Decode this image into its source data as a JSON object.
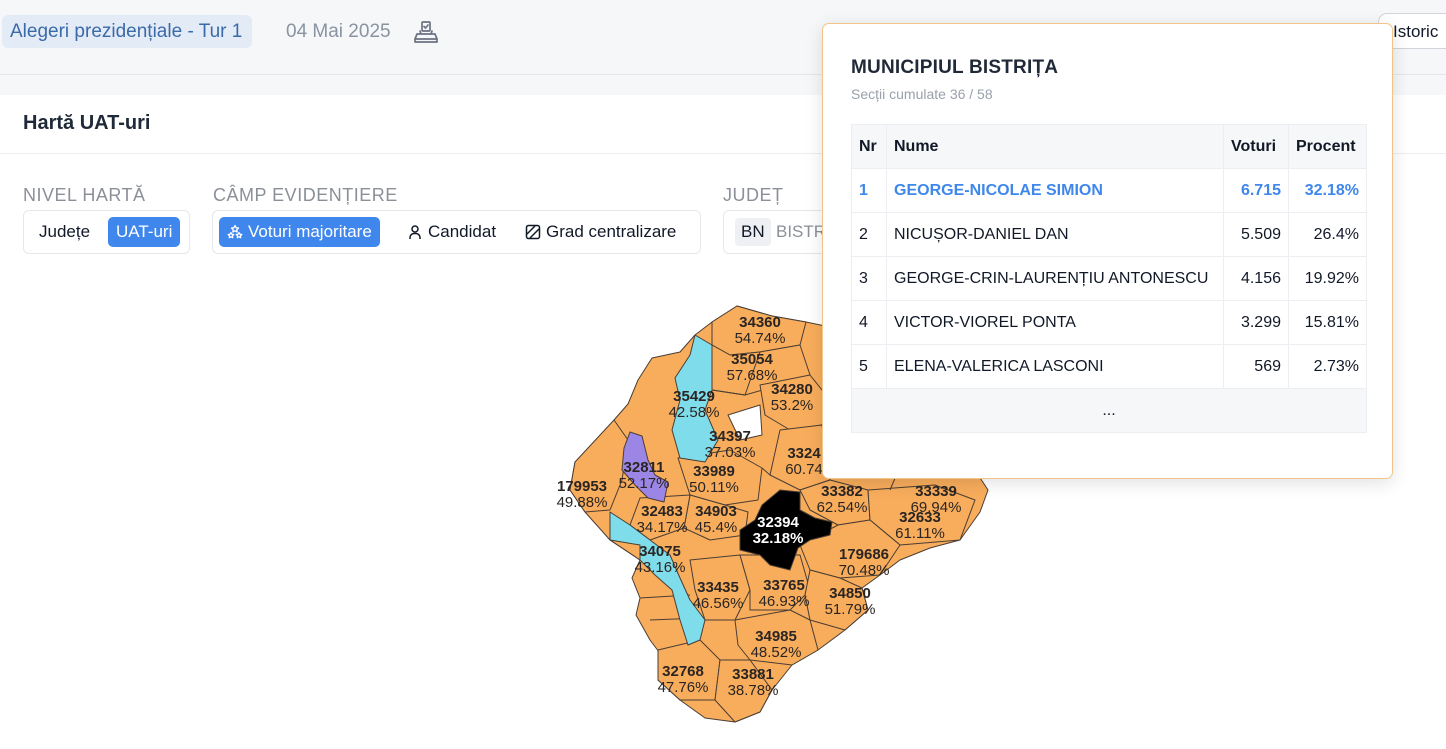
{
  "header": {
    "election_title": "Alegeri prezidențiale - Tur 1",
    "date": "04 Mai 2025",
    "ballot_icon": "ballot-box-icon",
    "history_label": "Istoric"
  },
  "card": {
    "title": "Hartă UAT-uri"
  },
  "controls": {
    "map_level": {
      "label": "NIVEL HARTĂ",
      "options": [
        "Județe",
        "UAT-uri"
      ],
      "selected": "UAT-uri"
    },
    "highlight_field": {
      "label": "CÂMP EVIDENȚIERE",
      "options": [
        {
          "label": "Voturi majoritare",
          "icon": "stars-icon"
        },
        {
          "label": "Candidat",
          "icon": "user-icon"
        },
        {
          "label": "Grad centralizare",
          "icon": "square-slash-icon"
        }
      ],
      "selected": "Voturi majoritare"
    },
    "county": {
      "label": "JUDEȚ",
      "code": "BN",
      "name": "BISTRIȚA-NĂSĂUD"
    }
  },
  "map": {
    "colors": {
      "orange": "#f8ad5c",
      "cyan": "#7fdceb",
      "purple": "#9b86e6",
      "selected": "#000000",
      "white": "#ffffff",
      "border": "#4a3d33"
    },
    "labels": [
      {
        "code": "34360",
        "pct": "54.74%"
      },
      {
        "code": "35054",
        "pct": "57.68%"
      },
      {
        "code": "34280",
        "pct": "53.2%"
      },
      {
        "code": "35429",
        "pct": "42.58%"
      },
      {
        "code": "34397",
        "pct": "37.03%"
      },
      {
        "code": "3324",
        "pct": "60.74"
      },
      {
        "code": "32811",
        "pct": "52.17%"
      },
      {
        "code": "33989",
        "pct": "50.11%"
      },
      {
        "code": "179953",
        "pct": "49.88%"
      },
      {
        "code": "33382",
        "pct": "62.54%"
      },
      {
        "code": "33339",
        "pct": "69.94%"
      },
      {
        "code": "32483",
        "pct": "34.17%"
      },
      {
        "code": "34903",
        "pct": "45.4%"
      },
      {
        "code": "32394",
        "pct": "32.18%"
      },
      {
        "code": "32633",
        "pct": "61.11%"
      },
      {
        "code": "34075",
        "pct": "43.16%"
      },
      {
        "code": "179686",
        "pct": "70.48%"
      },
      {
        "code": "33435",
        "pct": "46.56%"
      },
      {
        "code": "33765",
        "pct": "46.93%"
      },
      {
        "code": "34850",
        "pct": "51.79%"
      },
      {
        "code": "34985",
        "pct": "48.52%"
      },
      {
        "code": "32768",
        "pct": "47.76%"
      },
      {
        "code": "33881",
        "pct": "38.78%"
      }
    ]
  },
  "tooltip": {
    "title": "MUNICIPIUL BISTRIȚA",
    "subtitle": "Secții cumulate 36 / 58",
    "headers": {
      "nr": "Nr",
      "name": "Nume",
      "votes": "Voturi",
      "percent": "Procent"
    },
    "rows": [
      {
        "nr": "1",
        "name": "GEORGE-NICOLAE SIMION",
        "votes": "6.715",
        "percent": "32.18%"
      },
      {
        "nr": "2",
        "name": "NICUȘOR-DANIEL DAN",
        "votes": "5.509",
        "percent": "26.4%"
      },
      {
        "nr": "3",
        "name": "GEORGE-CRIN-LAURENȚIU ANTONESCU",
        "votes": "4.156",
        "percent": "19.92%"
      },
      {
        "nr": "4",
        "name": "VICTOR-VIOREL PONTA",
        "votes": "3.299",
        "percent": "15.81%"
      },
      {
        "nr": "5",
        "name": "ELENA-VALERICA LASCONI",
        "votes": "569",
        "percent": "2.73%"
      }
    ],
    "more": "..."
  }
}
